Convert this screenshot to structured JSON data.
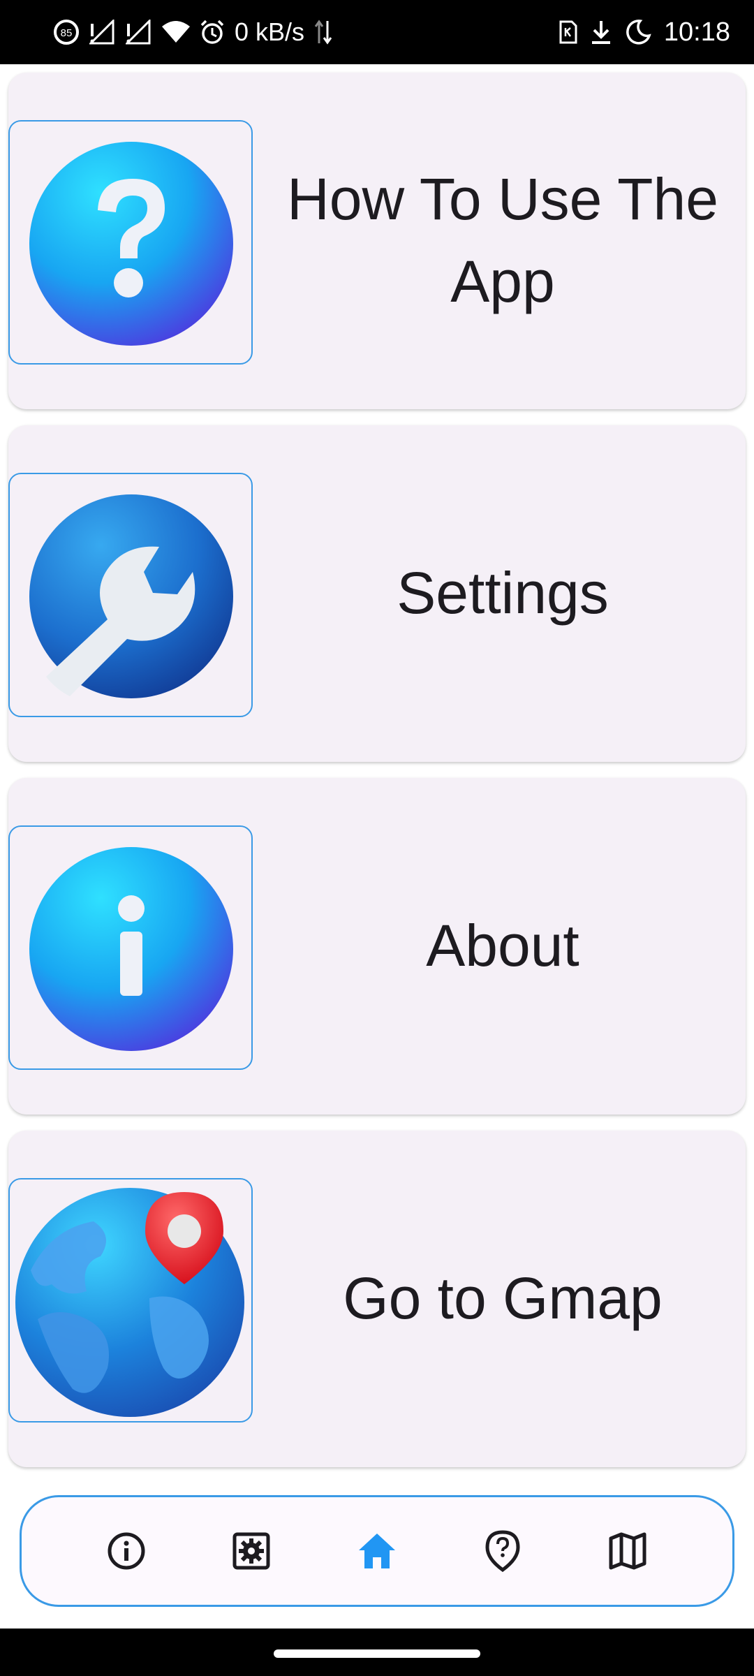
{
  "status_bar": {
    "battery_saver": "85",
    "net_speed": "0 kB/s",
    "time": "10:18"
  },
  "cards": [
    {
      "label": "How To Use The App",
      "icon": "question-icon"
    },
    {
      "label": "Settings",
      "icon": "wrench-icon"
    },
    {
      "label": "About",
      "icon": "info-icon"
    },
    {
      "label": "Go to Gmap",
      "icon": "globe-pin-icon"
    }
  ],
  "bottom_nav": {
    "items": [
      {
        "icon": "info-outline-icon",
        "active": false
      },
      {
        "icon": "settings-icon",
        "active": false
      },
      {
        "icon": "home-icon",
        "active": true
      },
      {
        "icon": "location-help-icon",
        "active": false
      },
      {
        "icon": "map-icon",
        "active": false
      }
    ],
    "active_color": "#2196f3",
    "inactive_color": "#1d1b20"
  },
  "colors": {
    "card_background": "#f5f0f7",
    "frame_border": "#3a9ae6"
  }
}
